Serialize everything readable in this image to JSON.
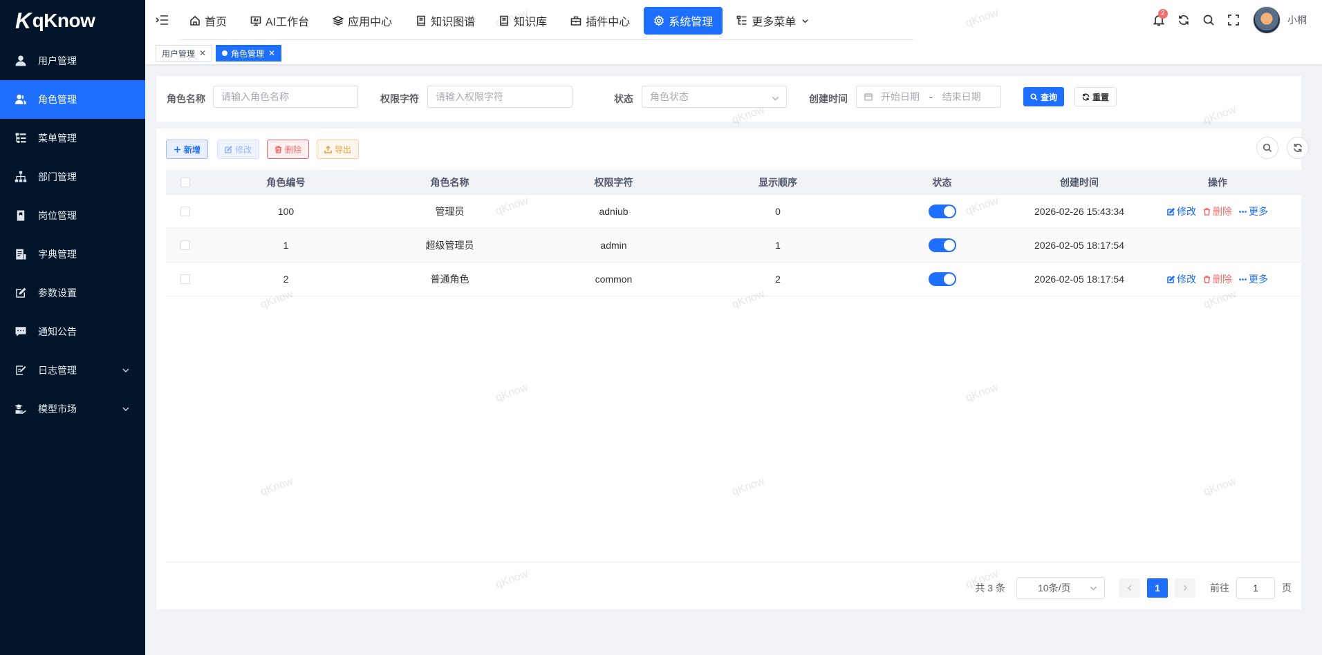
{
  "logo": {
    "mark": "K",
    "text": "qKnow"
  },
  "sidebar": {
    "items": [
      {
        "label": "用户管理",
        "icon": "user-icon",
        "active": false
      },
      {
        "label": "角色管理",
        "icon": "users-icon",
        "active": true
      },
      {
        "label": "菜单管理",
        "icon": "tree-table-icon",
        "active": false
      },
      {
        "label": "部门管理",
        "icon": "org-tree-icon",
        "active": false
      },
      {
        "label": "岗位管理",
        "icon": "post-icon",
        "active": false
      },
      {
        "label": "字典管理",
        "icon": "dictionary-icon",
        "active": false
      },
      {
        "label": "参数设置",
        "icon": "edit-icon",
        "active": false
      },
      {
        "label": "通知公告",
        "icon": "message-icon",
        "active": false
      },
      {
        "label": "日志管理",
        "icon": "log-icon",
        "active": false,
        "expandable": true
      },
      {
        "label": "模型市场",
        "icon": "model-icon",
        "active": false,
        "expandable": true
      }
    ]
  },
  "topnav": {
    "items": [
      {
        "label": "首页",
        "icon": "home-icon"
      },
      {
        "label": "AI工作台",
        "icon": "monitor-icon"
      },
      {
        "label": "应用中心",
        "icon": "layers-icon"
      },
      {
        "label": "知识图谱",
        "icon": "book-icon"
      },
      {
        "label": "知识库",
        "icon": "book-icon"
      },
      {
        "label": "插件中心",
        "icon": "briefcase-icon"
      },
      {
        "label": "系统管理",
        "icon": "gear-icon",
        "active": true
      },
      {
        "label": "更多菜单",
        "icon": "tree-table-icon",
        "dropdown": true
      }
    ],
    "notification_count": "2",
    "username": "小桐"
  },
  "tags": [
    {
      "label": "用户管理",
      "active": false
    },
    {
      "label": "角色管理",
      "active": true
    }
  ],
  "search": {
    "role_name_label": "角色名称",
    "role_name_placeholder": "请输入角色名称",
    "role_key_label": "权限字符",
    "role_key_placeholder": "请输入权限字符",
    "status_label": "状态",
    "status_placeholder": "角色状态",
    "created_label": "创建时间",
    "start_placeholder": "开始日期",
    "range_separator": "-",
    "end_placeholder": "结束日期",
    "query_label": "查询",
    "reset_label": "重置"
  },
  "toolbar": {
    "add_label": "新增",
    "edit_label": "修改",
    "delete_label": "删除",
    "export_label": "导出"
  },
  "table": {
    "headers": {
      "id": "角色编号",
      "name": "角色名称",
      "key": "权限字符",
      "order": "显示顺序",
      "status": "状态",
      "created": "创建时间",
      "ops": "操作"
    },
    "rows": [
      {
        "id": "100",
        "name": "管理员",
        "key": "adniub",
        "order": "0",
        "enabled": true,
        "created": "2026-02-26 15:43:34",
        "has_ops": true
      },
      {
        "id": "1",
        "name": "超级管理员",
        "key": "admin",
        "order": "1",
        "enabled": true,
        "created": "2026-02-05 18:17:54",
        "has_ops": false
      },
      {
        "id": "2",
        "name": "普通角色",
        "key": "common",
        "order": "2",
        "enabled": true,
        "created": "2026-02-05 18:17:54",
        "has_ops": true
      }
    ],
    "op_edit": "修改",
    "op_delete": "删除",
    "op_more": "更多"
  },
  "pagination": {
    "total_text": "共 3 条",
    "page_size": "10条/页",
    "current_page": "1",
    "goto_label": "前往",
    "goto_value": "1",
    "page_suffix": "页"
  },
  "watermark": "qKnow"
}
